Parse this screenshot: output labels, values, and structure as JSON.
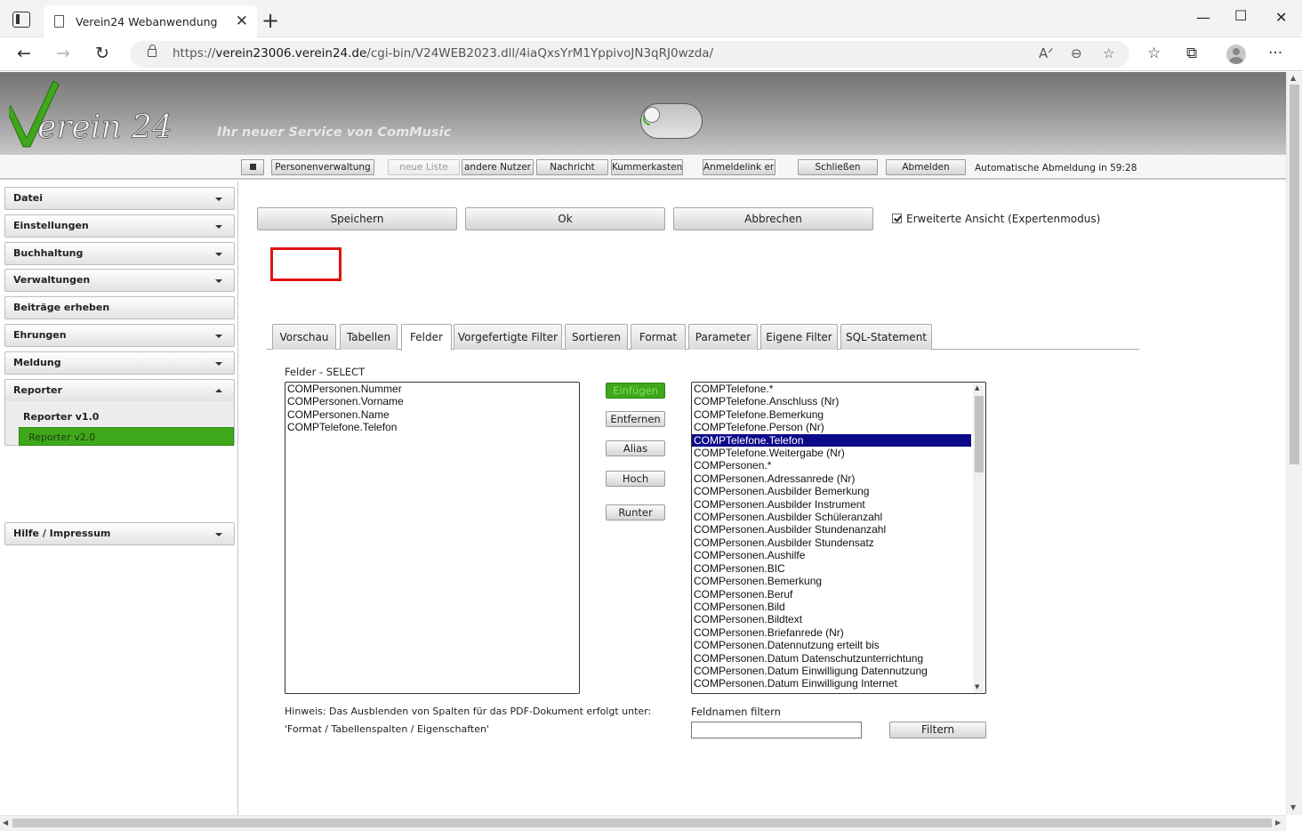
{
  "browser": {
    "tab_title": "Verein24 Webanwendung",
    "url_prefix": "https://",
    "url_host": "verein23006.verein24.de",
    "url_path": "/cgi-bin/V24WEB2023.dll/4iaQxsYrM1YppivoJN3qRJ0wzda/"
  },
  "header": {
    "logo_text": "Verein 24",
    "tagline": "Ihr neuer Service von ComMusic"
  },
  "topbar": {
    "buttons": [
      "Personenverwaltung",
      "neue Liste",
      "andere Nutzer",
      "Nachricht",
      "Kummerkasten",
      "Anmeldelink erst",
      "Schließen",
      "Abmelden"
    ],
    "auto_logout": "Automatische Abmeldung in 59:28"
  },
  "sidebar": {
    "items": [
      "Datei",
      "Einstellungen",
      "Buchhaltung",
      "Verwaltungen",
      "Beiträge erheben",
      "Ehrungen",
      "Meldung",
      "Reporter",
      "Hilfe / Impressum"
    ],
    "reporter_sub": [
      "Reporter v1.0",
      "Reporter v2.0"
    ],
    "active_sub": "Reporter v2.0"
  },
  "actions": {
    "save": "Speichern",
    "ok": "Ok",
    "cancel": "Abbrechen",
    "expert_mode": "Erweiterte Ansicht (Expertenmodus)",
    "expert_checked": true
  },
  "tabs": [
    "Vorschau",
    "Tabellen",
    "Felder",
    "Vorgefertigte Filter",
    "Sortieren",
    "Format",
    "Parameter",
    "Eigene Filter",
    "SQL-Statement"
  ],
  "active_tab": "Felder",
  "highlighted_tab": "Vorschau",
  "felder": {
    "label": "Felder - SELECT",
    "selected_fields": [
      "COMPersonen.Nummer",
      "COMPersonen.Vorname",
      "COMPersonen.Name",
      "COMPTelefone.Telefon"
    ],
    "buttons": {
      "insert": "Einfügen",
      "remove": "Entfernen",
      "alias": "Alias",
      "up": "Hoch",
      "down": "Runter"
    },
    "available_fields": [
      "COMPTelefone.*",
      "COMPTelefone.Anschluss (Nr)",
      "COMPTelefone.Bemerkung",
      "COMPTelefone.Person (Nr)",
      "COMPTelefone.Telefon",
      "COMPTelefone.Weitergabe (Nr)",
      "COMPersonen.*",
      "COMPersonen.Adressanrede (Nr)",
      "COMPersonen.Ausbilder Bemerkung",
      "COMPersonen.Ausbilder Instrument",
      "COMPersonen.Ausbilder Schüleranzahl",
      "COMPersonen.Ausbilder Stundenanzahl",
      "COMPersonen.Ausbilder Stundensatz",
      "COMPersonen.Aushilfe",
      "COMPersonen.BIC",
      "COMPersonen.Bemerkung",
      "COMPersonen.Beruf",
      "COMPersonen.Bild",
      "COMPersonen.Bildtext",
      "COMPersonen.Briefanrede (Nr)",
      "COMPersonen.Datennutzung erteilt bis",
      "COMPersonen.Datum Datenschutzunterrichtung",
      "COMPersonen.Datum Einwilligung Datennutzung",
      "COMPersonen.Datum Einwilligung Internet"
    ],
    "selected_available": "COMPTelefone.Telefon",
    "hint_line1": "Hinweis: Das Ausblenden von Spalten für das PDF-Dokument erfolgt unter:",
    "hint_line2": "'Format / Tabellenspalten / Eigenschaften'",
    "filter_label": "Feldnamen filtern",
    "filter_value": "",
    "filter_button": "Filtern"
  },
  "colors": {
    "accent_green": "#3fa81a",
    "selection_blue": "#0d0a8a",
    "highlight_red": "#e01212"
  }
}
